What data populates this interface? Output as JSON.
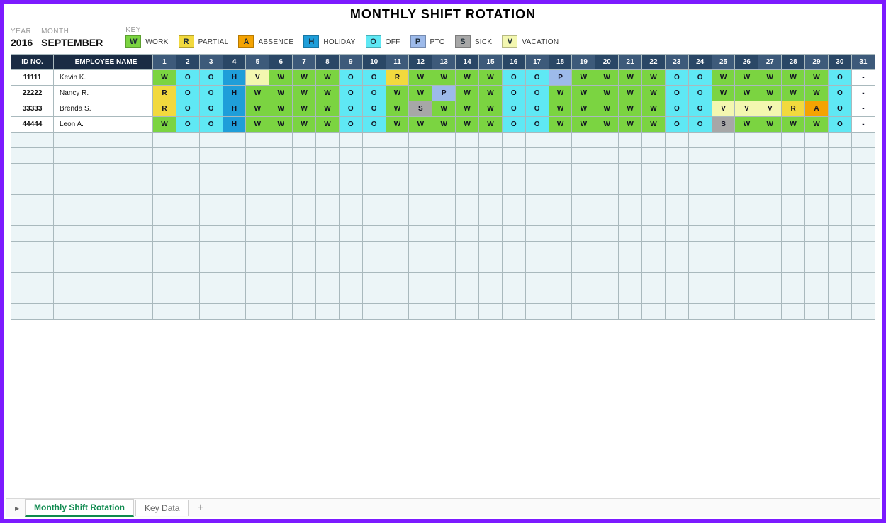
{
  "title": "MONTHLY SHIFT ROTATION",
  "meta": {
    "year_label": "YEAR",
    "year_value": "2016",
    "month_label": "MONTH",
    "month_value": "SEPTEMBER",
    "key_label": "KEY"
  },
  "legend": [
    {
      "code": "W",
      "label": "WORK",
      "cls": "c-W"
    },
    {
      "code": "R",
      "label": "PARTIAL",
      "cls": "c-R"
    },
    {
      "code": "A",
      "label": "ABSENCE",
      "cls": "c-A"
    },
    {
      "code": "H",
      "label": "HOLIDAY",
      "cls": "c-H"
    },
    {
      "code": "O",
      "label": "OFF",
      "cls": "c-O"
    },
    {
      "code": "P",
      "label": "PTO",
      "cls": "c-P"
    },
    {
      "code": "S",
      "label": "SICK",
      "cls": "c-S"
    },
    {
      "code": "V",
      "label": "VACATION",
      "cls": "c-V"
    }
  ],
  "headers": {
    "id": "ID NO.",
    "name": "EMPLOYEE NAME",
    "days": [
      "1",
      "2",
      "3",
      "4",
      "5",
      "6",
      "7",
      "8",
      "9",
      "10",
      "11",
      "12",
      "13",
      "14",
      "15",
      "16",
      "17",
      "18",
      "19",
      "20",
      "21",
      "22",
      "23",
      "24",
      "25",
      "26",
      "27",
      "28",
      "29",
      "30",
      "31"
    ]
  },
  "rows": [
    {
      "id": "11111",
      "name": "Kevin K.",
      "cells": [
        "W",
        "O",
        "O",
        "H",
        "V",
        "W",
        "W",
        "W",
        "O",
        "O",
        "R",
        "W",
        "W",
        "W",
        "W",
        "O",
        "O",
        "P",
        "W",
        "W",
        "W",
        "W",
        "O",
        "O",
        "W",
        "W",
        "W",
        "W",
        "W",
        "O",
        "-"
      ]
    },
    {
      "id": "22222",
      "name": "Nancy R.",
      "cells": [
        "R",
        "O",
        "O",
        "H",
        "W",
        "W",
        "W",
        "W",
        "O",
        "O",
        "W",
        "W",
        "P",
        "W",
        "W",
        "O",
        "O",
        "W",
        "W",
        "W",
        "W",
        "W",
        "O",
        "O",
        "W",
        "W",
        "W",
        "W",
        "W",
        "O",
        "-"
      ]
    },
    {
      "id": "33333",
      "name": "Brenda S.",
      "cells": [
        "R",
        "O",
        "O",
        "H",
        "W",
        "W",
        "W",
        "W",
        "O",
        "O",
        "W",
        "S",
        "W",
        "W",
        "W",
        "O",
        "O",
        "W",
        "W",
        "W",
        "W",
        "W",
        "O",
        "O",
        "V",
        "V",
        "V",
        "R",
        "A",
        "O",
        "-"
      ]
    },
    {
      "id": "44444",
      "name": "Leon A.",
      "cells": [
        "W",
        "O",
        "O",
        "H",
        "W",
        "W",
        "W",
        "W",
        "O",
        "O",
        "W",
        "W",
        "W",
        "W",
        "W",
        "O",
        "O",
        "W",
        "W",
        "W",
        "W",
        "W",
        "O",
        "O",
        "S",
        "W",
        "W",
        "W",
        "W",
        "O",
        "-"
      ]
    }
  ],
  "empty_row_count": 12,
  "tabs": {
    "active": "Monthly Shift Rotation",
    "others": [
      "Key Data"
    ],
    "add": "+"
  },
  "code_class_map": {
    "W": "c-W",
    "R": "c-R",
    "A": "c-A",
    "H": "c-H",
    "O": "c-O",
    "P": "c-P",
    "S": "c-S",
    "V": "c-V",
    "-": "c-dash"
  }
}
